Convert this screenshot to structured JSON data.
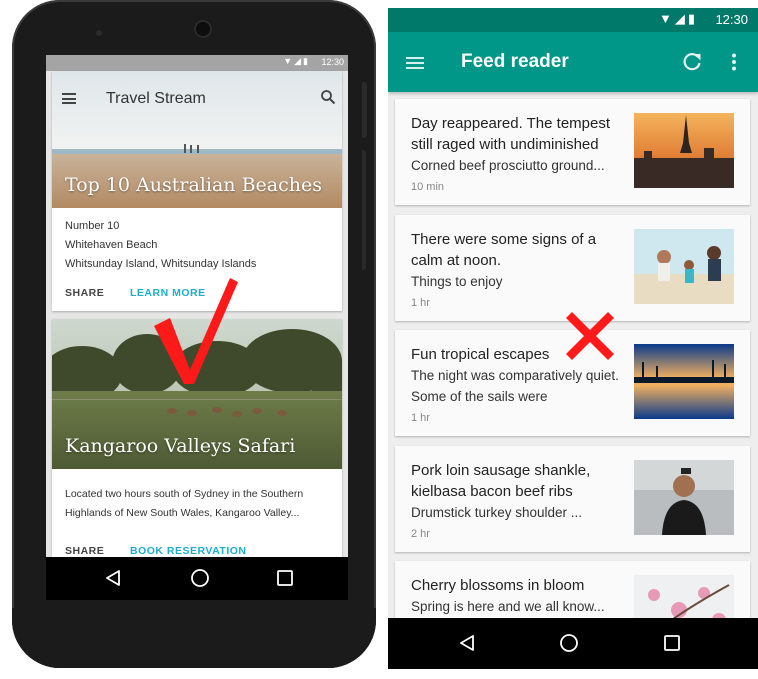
{
  "left_phone": {
    "status_time": "12:30",
    "toolbar": {
      "title": "Travel Stream"
    },
    "cards": [
      {
        "image_title": "Top 10 Australian Beaches",
        "lines": [
          "Number 10",
          "Whitehaven Beach",
          "Whitsunday Island, Whitsunday Islands"
        ],
        "share_label": "SHARE",
        "action_label": "LEARN MORE"
      },
      {
        "image_title": "Kangaroo Valleys Safari",
        "lines": [
          "Located two hours south of Sydney in the Southern",
          "Highlands of New South Wales, Kangaroo Valley..."
        ],
        "share_label": "SHARE",
        "action_label": "BOOK RESERVATION"
      }
    ],
    "accent_color": "#1eaecb",
    "verdict_mark": "check",
    "verdict_color": "#ff0000"
  },
  "right_screen": {
    "status_time": "12:30",
    "toolbar": {
      "title": "Feed reader"
    },
    "toolbar_color": "#009688",
    "statusbar_color": "#00796b",
    "feed": [
      {
        "title": "Day reappeared. The tempest still raged with undiminished",
        "snippet": "Corned beef prosciutto ground...",
        "time": "10 min",
        "thumb": "city-sunset"
      },
      {
        "title": "There were some signs of a calm at noon.",
        "snippet": "Things to enjoy",
        "time": "1 hr",
        "thumb": "family-beach"
      },
      {
        "title": "Fun tropical escapes",
        "snippet": "The night was comparatively quiet. Some of the sails were",
        "time": "1 hr",
        "thumb": "palm-reflection"
      },
      {
        "title": "Pork loin sausage shankle, kielbasa bacon beef ribs",
        "snippet": "Drumstick turkey shoulder ...",
        "time": "2 hr",
        "thumb": "man-portrait"
      },
      {
        "title": "Cherry blossoms in bloom",
        "snippet": "Spring is here and we all know...",
        "time": "",
        "thumb": "cherry-blossoms"
      }
    ],
    "verdict_mark": "cross",
    "verdict_color": "#ff0000"
  }
}
